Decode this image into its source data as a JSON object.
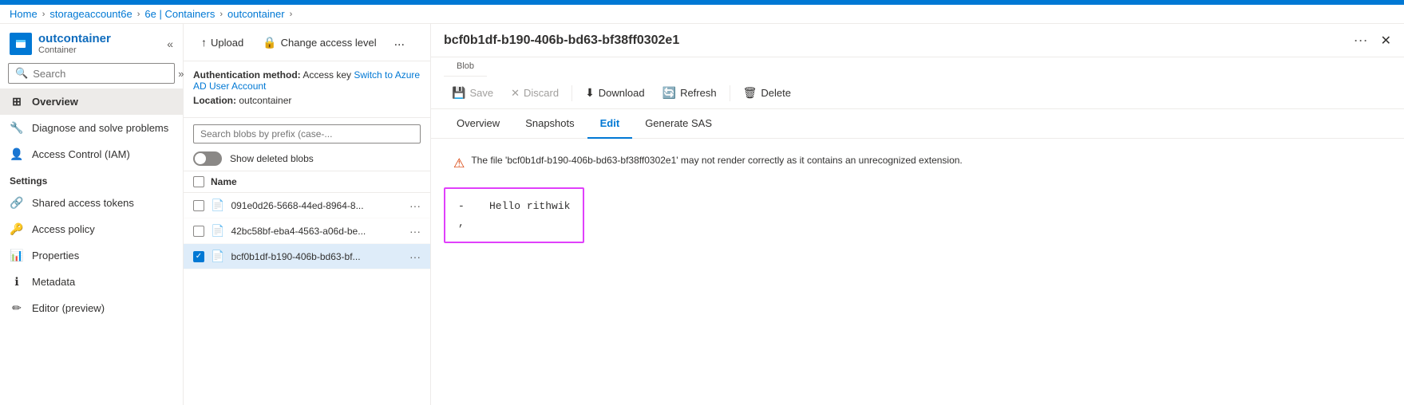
{
  "topbar": {
    "color": "#0078d4"
  },
  "breadcrumb": {
    "items": [
      "Home",
      "storageaccount6e",
      "6e | Containers",
      "outcontainer"
    ],
    "separators": [
      ">",
      ">",
      ">",
      ">"
    ]
  },
  "sidebar": {
    "title": "outcontainer",
    "subtitle": "Container",
    "collapse_label": "«",
    "search_placeholder": "Search",
    "nav_items": [
      {
        "label": "Overview",
        "active": true,
        "icon": "overview"
      },
      {
        "label": "Diagnose and solve problems",
        "active": false,
        "icon": "diagnose"
      },
      {
        "label": "Access Control (IAM)",
        "active": false,
        "icon": "access-control"
      }
    ],
    "settings_label": "Settings",
    "settings_items": [
      {
        "label": "Shared access tokens",
        "icon": "shared-token"
      },
      {
        "label": "Access policy",
        "icon": "access-policy"
      },
      {
        "label": "Properties",
        "icon": "properties"
      },
      {
        "label": "Metadata",
        "icon": "metadata"
      },
      {
        "label": "Editor (preview)",
        "icon": "editor"
      }
    ]
  },
  "middle": {
    "toolbar": {
      "upload_label": "Upload",
      "change_access_label": "Change access level",
      "more_label": "..."
    },
    "auth": {
      "method_label": "Authentication method:",
      "method_value": "Access key",
      "switch_link": "Switch to Azure AD User Account",
      "location_label": "Location:",
      "location_value": "outcontainer"
    },
    "blob_search_placeholder": "Search blobs by prefix (case-...",
    "show_deleted_label": "Show deleted blobs",
    "list_header": "Name",
    "blobs": [
      {
        "name": "091e0d26-5668-44ed-8964-8...",
        "checked": false,
        "selected": false
      },
      {
        "name": "42bc58bf-eba4-4563-a06d-be...",
        "checked": false,
        "selected": false
      },
      {
        "name": "bcf0b1df-b190-406b-bd63-bf...",
        "checked": true,
        "selected": true
      }
    ]
  },
  "right": {
    "title": "bcf0b1df-b190-406b-bd63-bf38ff0302e1",
    "subtitle": "Blob",
    "more_label": "···",
    "close_label": "✕",
    "toolbar": {
      "save_label": "Save",
      "discard_label": "Discard",
      "download_label": "Download",
      "refresh_label": "Refresh",
      "delete_label": "Delete"
    },
    "tabs": [
      {
        "label": "Overview",
        "active": false
      },
      {
        "label": "Snapshots",
        "active": false
      },
      {
        "label": "Edit",
        "active": true
      },
      {
        "label": "Generate SAS",
        "active": false
      }
    ],
    "warning_text": "The file 'bcf0b1df-b190-406b-bd63-bf38ff0302e1' may not render correctly as it contains an unrecognized extension.",
    "editor_content": "- Hello rithwik\n,"
  }
}
